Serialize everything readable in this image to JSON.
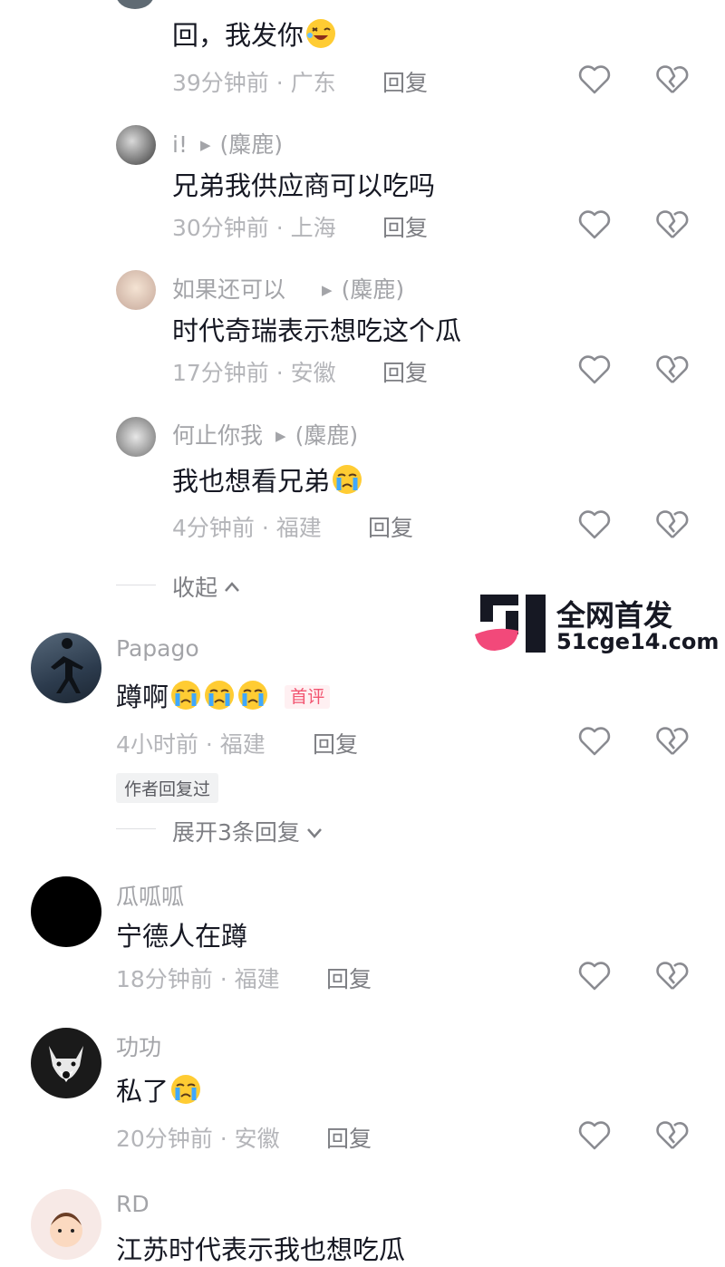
{
  "comments": [
    {
      "text": "回，我发你",
      "meta": "39分钟前 · 广东",
      "reply": "回复"
    },
    {
      "name": "i!",
      "target": "(麋鹿)",
      "text": "兄弟我供应商可以吃吗",
      "meta": "30分钟前 · 上海",
      "reply": "回复"
    },
    {
      "name": "如果还可以",
      "target": "(麋鹿)",
      "text": "时代奇瑞表示想吃这个瓜",
      "meta": "17分钟前 · 安徽",
      "reply": "回复"
    },
    {
      "name": "何止你我",
      "target": "(麋鹿)",
      "text": "我也想看兄弟",
      "meta": "4分钟前 · 福建",
      "reply": "回复"
    },
    {
      "name": "Papago",
      "text": "蹲啊",
      "badge": "首评",
      "meta": "4小时前 · 福建",
      "reply": "回复",
      "author_tag": "作者回复过",
      "expand": "展开3条回复"
    },
    {
      "name": "瓜呱呱",
      "text": "宁德人在蹲",
      "meta": "18分钟前 · 福建",
      "reply": "回复"
    },
    {
      "name": "功功",
      "text": "私了",
      "meta": "20分钟前 · 安徽",
      "reply": "回复"
    },
    {
      "name": "RD",
      "text": "江苏时代表示我也想吃瓜"
    }
  ],
  "collapse_label": "收起",
  "watermark": {
    "line1": "全网首发",
    "line2": "51cge14.com"
  },
  "colors": {
    "accent_pink": "#f25571",
    "text": "#161823",
    "meta": "#b4b5b9"
  }
}
